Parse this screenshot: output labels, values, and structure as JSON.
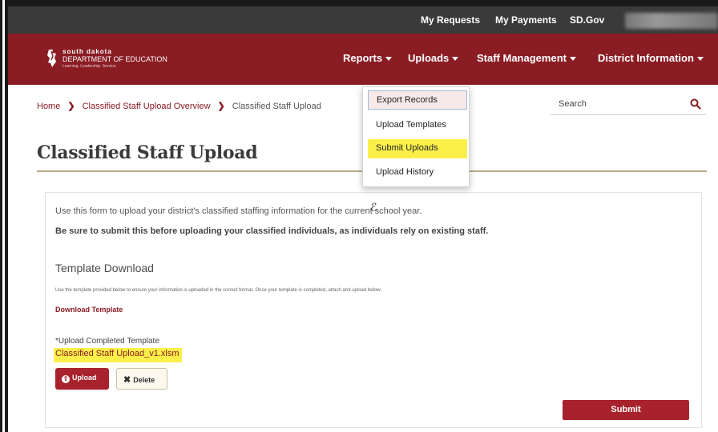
{
  "topbar": {
    "links": [
      "My Requests",
      "My Payments",
      "SD.Gov"
    ]
  },
  "brand": {
    "line1": "south dakota",
    "line2": "DEPARTMENT OF EDUCATION",
    "tagline": "Learning. Leadership. Service."
  },
  "nav": {
    "items": [
      "Reports",
      "Uploads",
      "Staff Management",
      "District Information"
    ]
  },
  "breadcrumb": {
    "home": "Home",
    "overview": "Classified Staff Upload Overview",
    "current": "Classified Staff Upload"
  },
  "search": {
    "placeholder": "Search"
  },
  "uploads_menu": {
    "items": [
      "Export Records",
      "Upload Templates",
      "Submit Uploads",
      "Upload History"
    ]
  },
  "page": {
    "title": "Classified Staff Upload",
    "intro": "Use this form to upload your district's classified staffing information for the current school year.",
    "intro_bold": "Be sure to submit this before uploading your classified individuals, as individuals rely on existing staff.",
    "template_heading": "Template Download",
    "template_desc": "Use the template provided below to ensure your information is uploaded in the correct format. Once your template is completed, attach and upload below.",
    "download_link": "Download Template",
    "upload_label": "*Upload Completed Template",
    "file_name": "Classified Staff Upload_v1.xlsm",
    "upload_button": "Upload",
    "delete_button": "Delete",
    "submit_button": "Submit"
  },
  "colors": {
    "brand_red": "#8a1c24",
    "button_red": "#a8222c",
    "highlight_yellow": "#fbf04a",
    "topbar_dark": "#3a3a3a"
  }
}
